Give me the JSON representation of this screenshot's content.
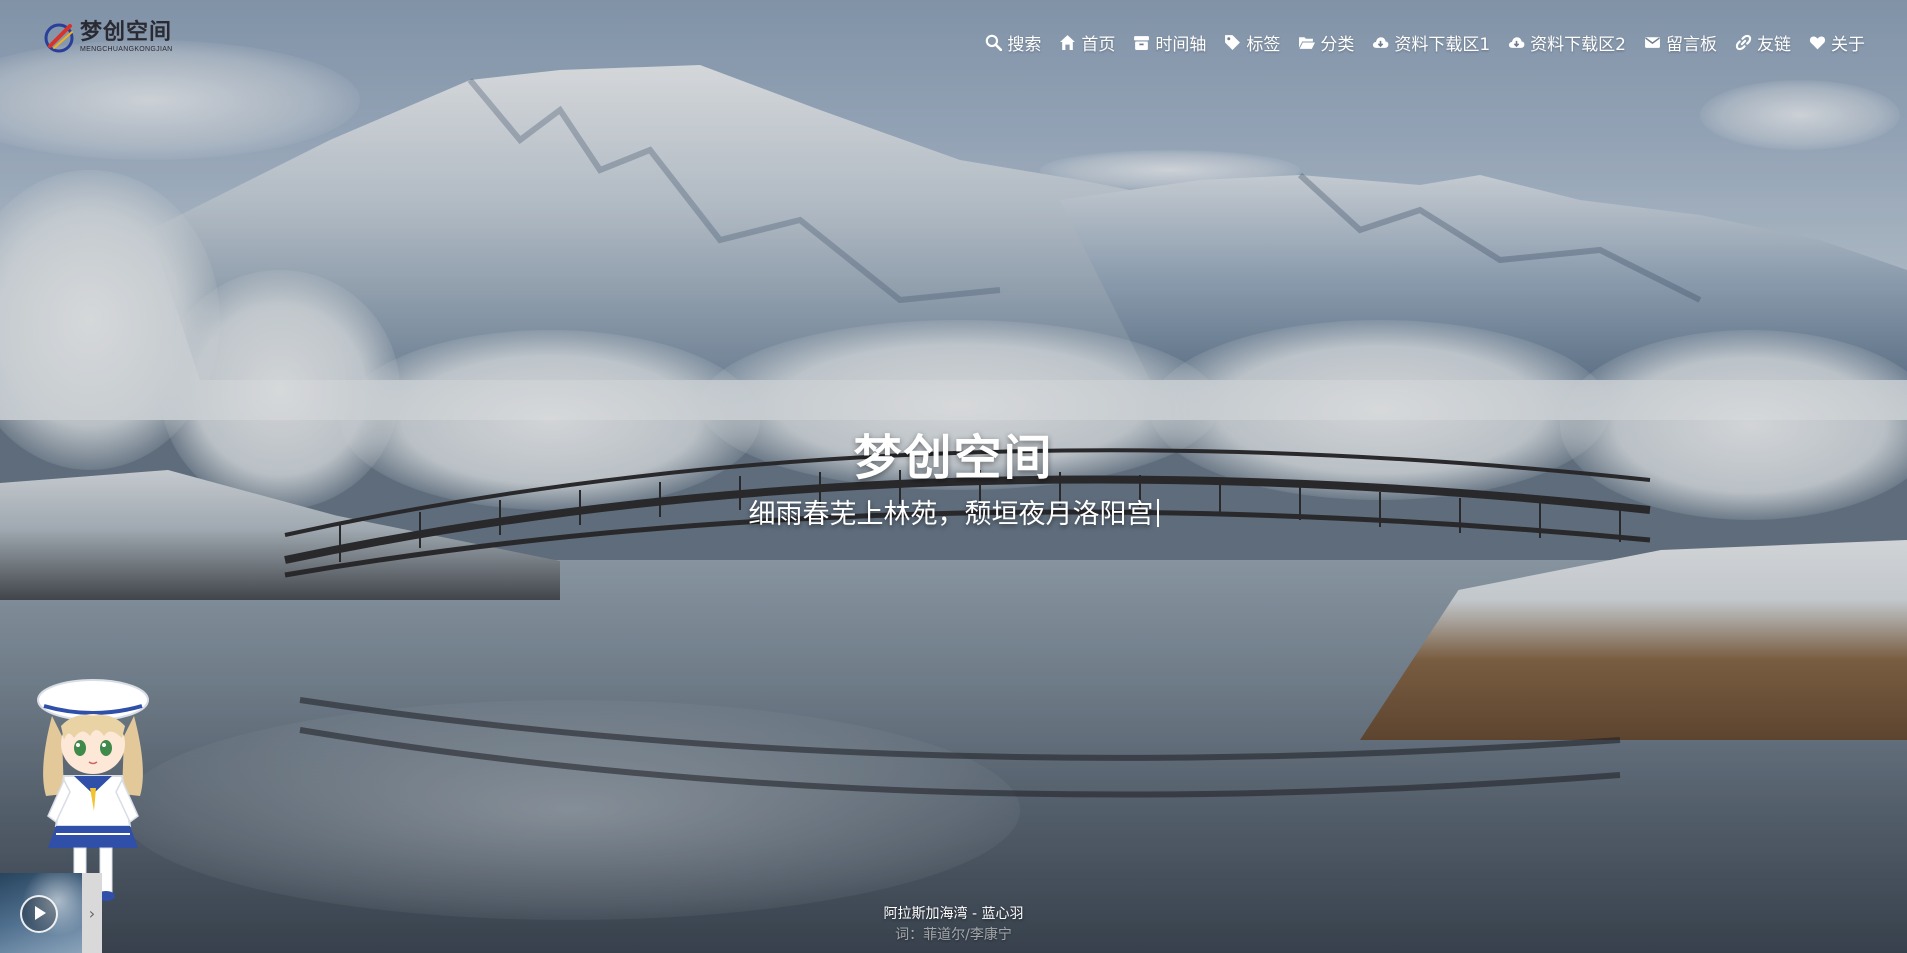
{
  "site": {
    "logo_title": "梦创空间",
    "logo_subtitle": "MENGCHUANGKONGJIAN"
  },
  "nav": [
    {
      "icon": "search-icon",
      "label": "搜索"
    },
    {
      "icon": "home-icon",
      "label": "首页"
    },
    {
      "icon": "archive-icon",
      "label": "时间轴"
    },
    {
      "icon": "tags-icon",
      "label": "标签"
    },
    {
      "icon": "folder-open-icon",
      "label": "分类"
    },
    {
      "icon": "cloud-download-icon",
      "label": "资料下载区1"
    },
    {
      "icon": "cloud-download-icon",
      "label": "资料下载区2"
    },
    {
      "icon": "envelope-icon",
      "label": "留言板"
    },
    {
      "icon": "link-icon",
      "label": "友链"
    },
    {
      "icon": "heart-icon",
      "label": "关于"
    }
  ],
  "hero": {
    "title": "梦创空间",
    "subtitle": "细雨春芜上林苑，颓垣夜月洛阳宫"
  },
  "player": {
    "play_icon": "play-icon",
    "toggle_icon": "chevron-right-icon",
    "toggle_glyph": "›"
  },
  "lyrics": {
    "now_playing": "阿拉斯加海湾 - 蓝心羽",
    "credit": "词：菲道尔/李康宁"
  },
  "colors": {
    "nav_text": "#ffffff",
    "hero_text": "#ffffff",
    "logo_text": "#2a2a33"
  }
}
